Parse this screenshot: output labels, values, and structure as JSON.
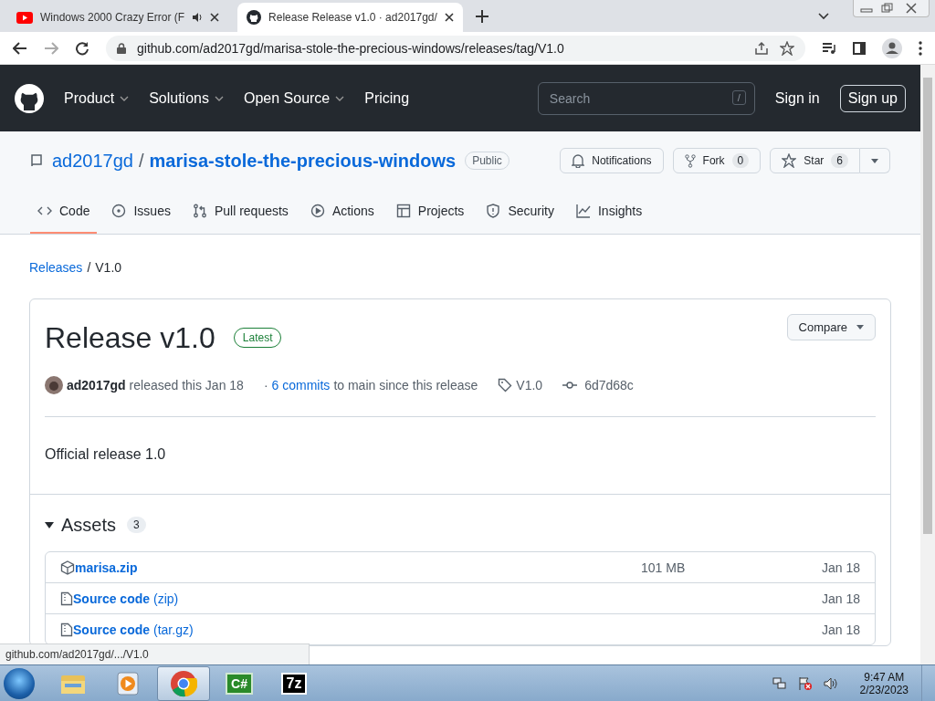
{
  "browser": {
    "tabs": [
      {
        "kind": "youtube",
        "title": "Windows 2000 Crazy Error (F",
        "audio": true,
        "selected": false
      },
      {
        "kind": "github",
        "title": "Release Release v1.0 · ad2017gd/",
        "audio": false,
        "selected": true
      }
    ],
    "address": "github.com/ad2017gd/marisa-stole-the-precious-windows/releases/tag/V1.0"
  },
  "header": {
    "nav": [
      {
        "label": "Product",
        "dropdown": true
      },
      {
        "label": "Solutions",
        "dropdown": true
      },
      {
        "label": "Open Source",
        "dropdown": true
      },
      {
        "label": "Pricing",
        "dropdown": false
      }
    ],
    "search": {
      "placeholder": "Search",
      "shortcut": "/"
    },
    "sign_in": "Sign in",
    "sign_up": "Sign up"
  },
  "repo": {
    "owner": "ad2017gd",
    "separator": "/",
    "name": "marisa-stole-the-precious-windows",
    "visibility": "Public",
    "notifications": "Notifications",
    "fork": {
      "label": "Fork",
      "count": "0"
    },
    "star": {
      "label": "Star",
      "count": "6"
    },
    "tabs": [
      {
        "kind": "code",
        "label": "Code",
        "selected": true
      },
      {
        "kind": "issues",
        "label": "Issues",
        "selected": false
      },
      {
        "kind": "pulls",
        "label": "Pull requests",
        "selected": false
      },
      {
        "kind": "actions",
        "label": "Actions",
        "selected": false
      },
      {
        "kind": "projects",
        "label": "Projects",
        "selected": false
      },
      {
        "kind": "security",
        "label": "Security",
        "selected": false
      },
      {
        "kind": "insights",
        "label": "Insights",
        "selected": false
      }
    ]
  },
  "breadcrumb": {
    "link": "Releases",
    "separator": "/",
    "current": "V1.0"
  },
  "release": {
    "title": "Release v1.0",
    "badge": "Latest",
    "compare": "Compare",
    "author": "ad2017gd",
    "released": "released this Jan 18",
    "commits_prefix": "·",
    "commits": "6 commits",
    "commits_suffix": "to main since this release",
    "tag": "V1.0",
    "commit": "6d7d68c",
    "body": "Official release 1.0"
  },
  "assets": {
    "title": "Assets",
    "count": "3",
    "expanded": true,
    "files": [
      {
        "kind": "package",
        "name": "marisa.zip",
        "size": "101 MB",
        "date": "Jan 18"
      },
      {
        "kind": "source",
        "name": "Source code",
        "suffix": "(zip)",
        "date": "Jan 18"
      },
      {
        "kind": "source",
        "name": "Source code",
        "suffix": "(tar.gz)",
        "date": "Jan 18"
      }
    ]
  },
  "status_url": "github.com/ad2017gd/.../V1.0",
  "taskbar": {
    "apps": [
      {
        "kind": "explorer",
        "active": false
      },
      {
        "kind": "media",
        "active": false
      },
      {
        "kind": "chrome",
        "active": true
      },
      {
        "kind": "csharp",
        "label": "C#",
        "active": false
      },
      {
        "kind": "sevenzip",
        "label": "7z",
        "active": false
      }
    ],
    "time": "9:47 AM",
    "date": "2/23/2023"
  }
}
